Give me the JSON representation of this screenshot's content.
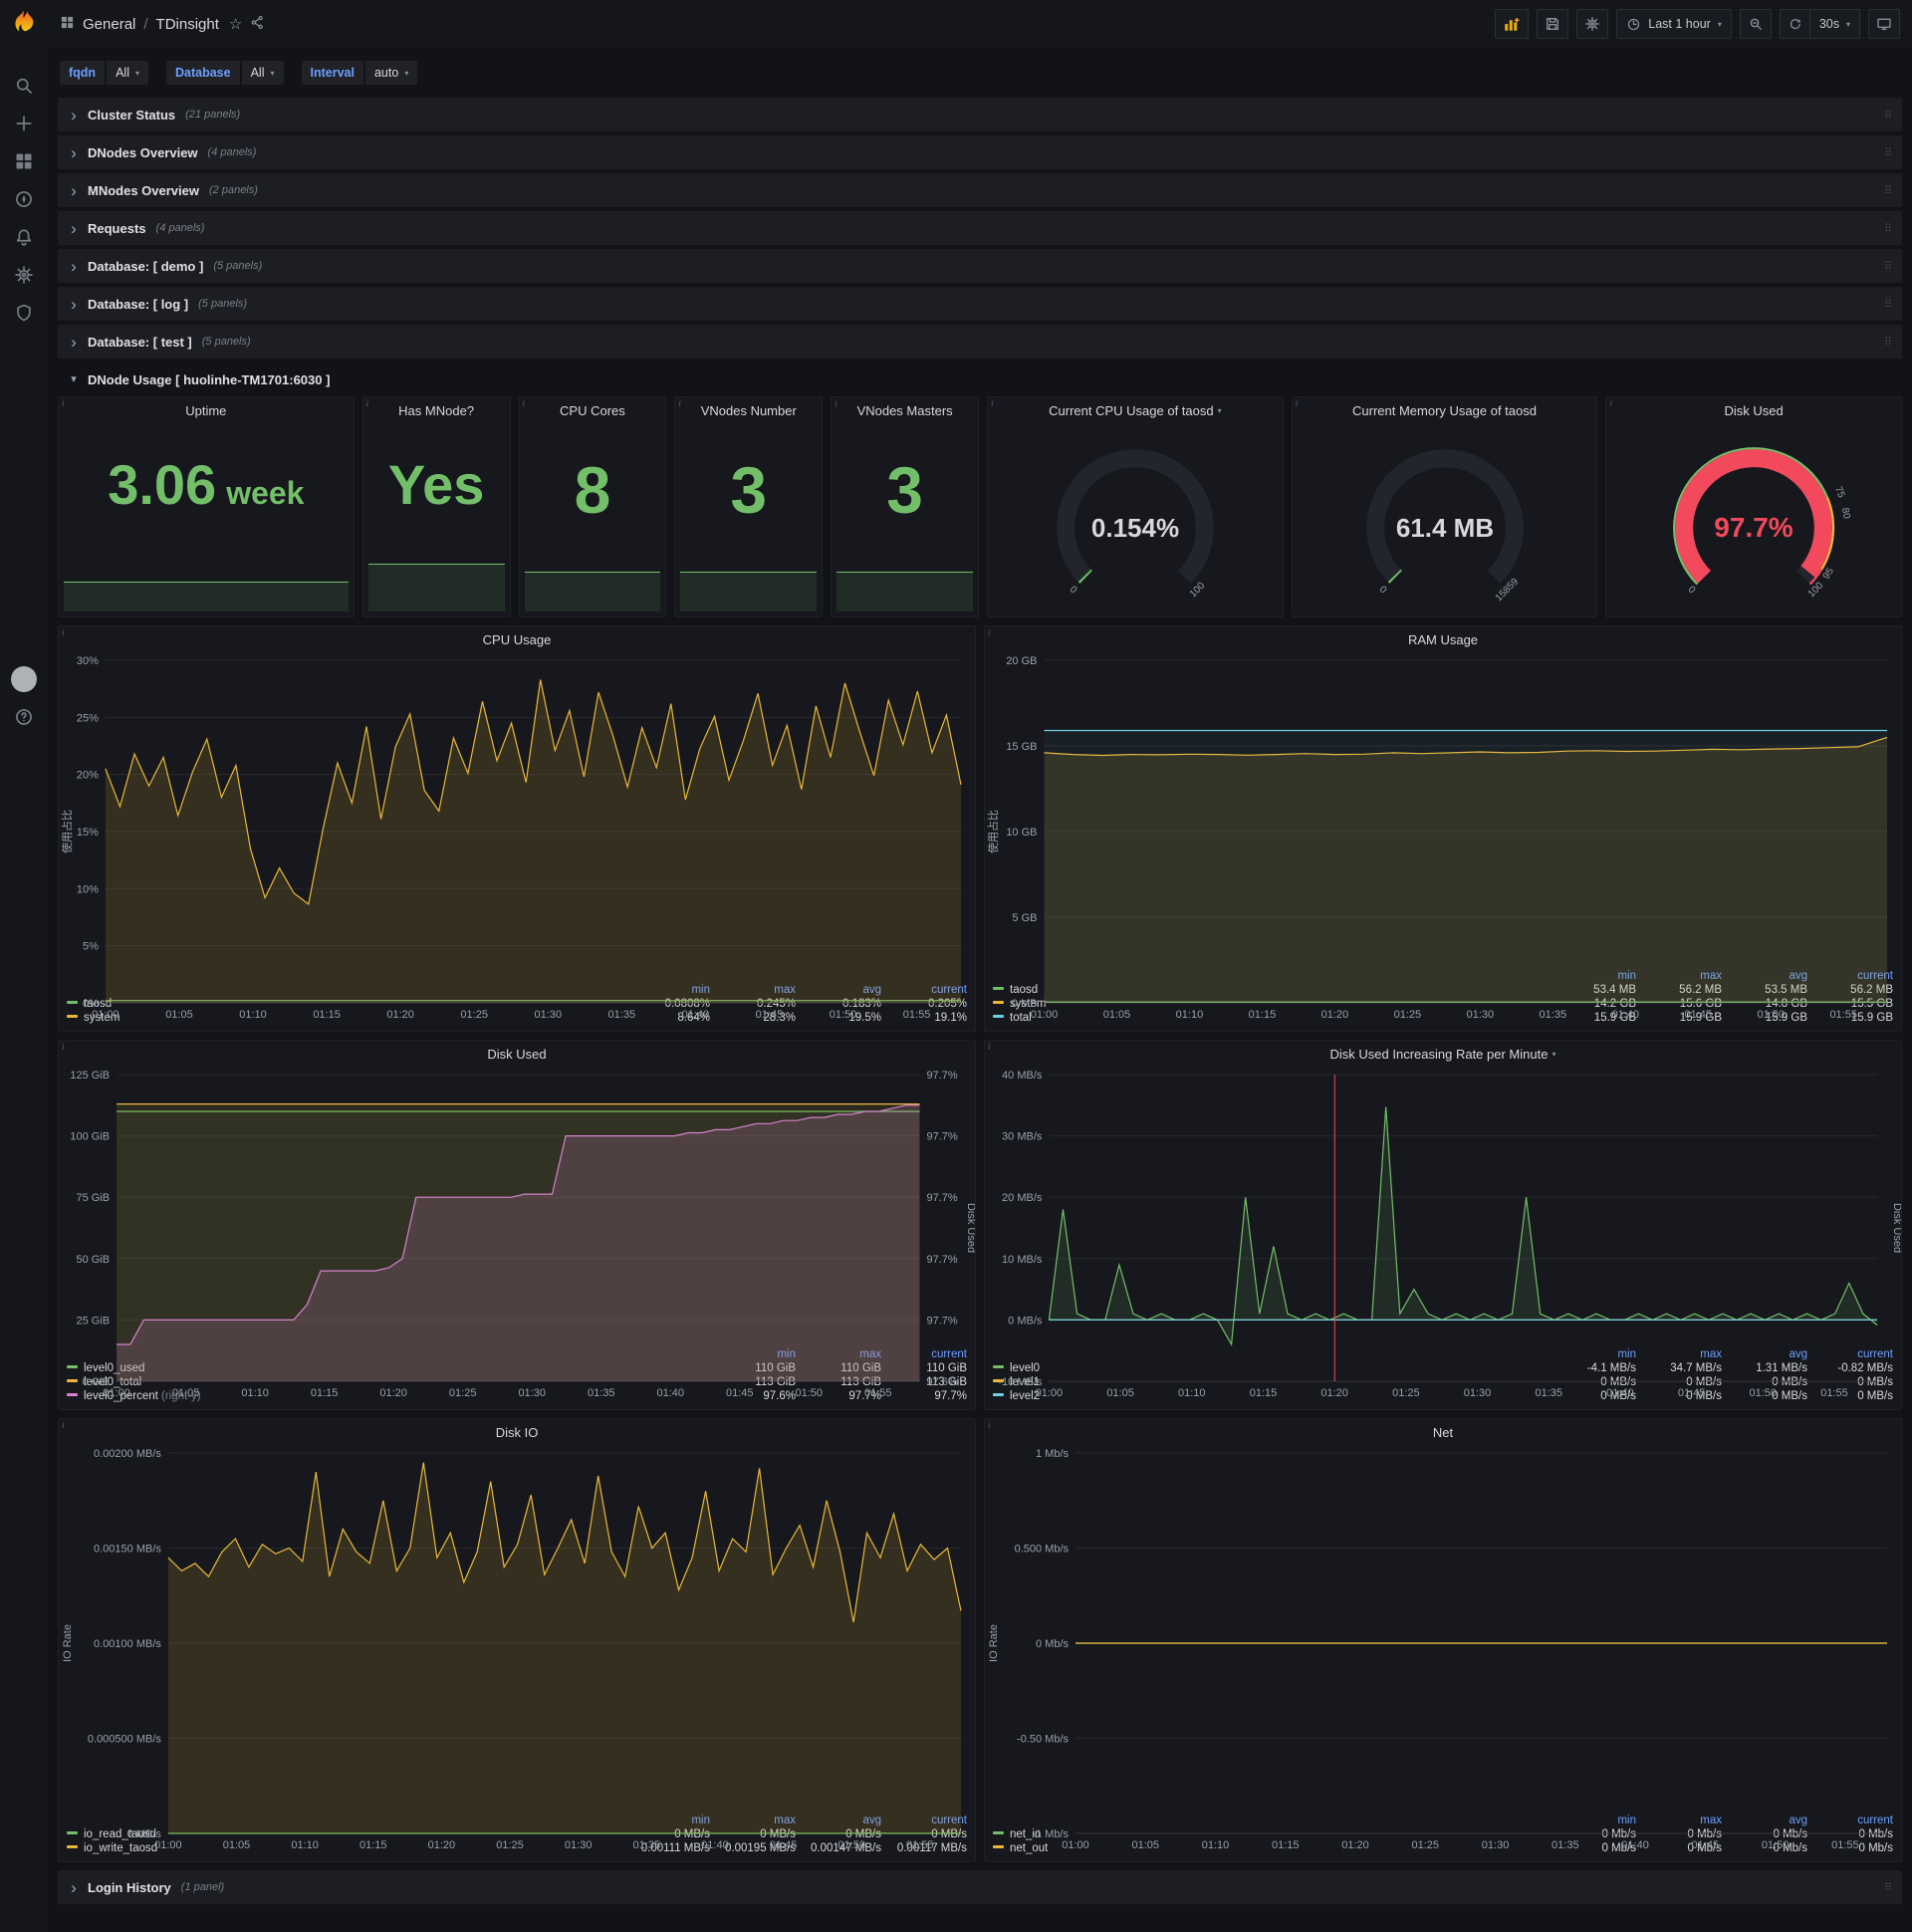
{
  "navbar": {
    "section": "General",
    "title": "TDinsight",
    "time_range": "Last 1 hour",
    "refresh": "30s"
  },
  "glyphs": {
    "info": "i",
    "caret": "▾",
    "collapsed": "›",
    "expanded": "▾",
    "drag": "⠿",
    "star": "☆",
    "sep": "/"
  },
  "colors": {
    "green": "#73bf69",
    "yellow": "#eab839",
    "cyan": "#6ed0e0",
    "red": "#f2495c",
    "pink": "#d683ce",
    "accent_blue": "#6e9fff"
  },
  "variables": [
    {
      "label": "fqdn",
      "value": "All"
    },
    {
      "label": "Database",
      "value": "All"
    },
    {
      "label": "Interval",
      "value": "auto"
    }
  ],
  "rows": [
    {
      "title": "Cluster Status",
      "count": "(21 panels)"
    },
    {
      "title": "DNodes Overview",
      "count": "(4 panels)"
    },
    {
      "title": "MNodes Overview",
      "count": "(2 panels)"
    },
    {
      "title": "Requests",
      "count": "(4 panels)"
    },
    {
      "title": "Database: [ demo ]",
      "count": "(5 panels)"
    },
    {
      "title": "Database: [ log ]",
      "count": "(5 panels)"
    },
    {
      "title": "Database: [ test ]",
      "count": "(5 panels)"
    }
  ],
  "expanded_row_title": "DNode Usage [ huolinhe-TM1701:6030 ]",
  "bottom_row": {
    "title": "Login History",
    "count": "(1 panel)"
  },
  "stats": [
    {
      "title": "Uptime",
      "value": "3.06",
      "unit": "week"
    },
    {
      "title": "Has MNode?",
      "value": "Yes",
      "unit": ""
    },
    {
      "title": "CPU Cores",
      "value": "8",
      "unit": ""
    },
    {
      "title": "VNodes Number",
      "value": "3",
      "unit": ""
    },
    {
      "title": "VNodes Masters",
      "value": "3",
      "unit": ""
    }
  ],
  "gauges": [
    {
      "title": "Current CPU Usage of taosd",
      "has_caret": true,
      "value": "0.154%",
      "fraction": 0.00154,
      "color": "#73bf69",
      "value_color": "#d8d9da",
      "font": 26,
      "scale_labels": [
        {
          "at": 0,
          "text": "0"
        },
        {
          "at": 1,
          "text": "100"
        }
      ]
    },
    {
      "title": "Current Memory Usage of taosd",
      "value": "61.4 MB",
      "fraction": 0.0039,
      "color": "#73bf69",
      "value_color": "#d8d9da",
      "font": 26,
      "scale_labels": [
        {
          "at": 0,
          "text": "0"
        },
        {
          "at": 1,
          "text": "15859"
        }
      ]
    },
    {
      "title": "Disk Used",
      "value": "97.7%",
      "fraction": 0.977,
      "color": "#f2495c",
      "value_color": "#f2495c",
      "font": 28,
      "scale_labels": [
        {
          "at": 0,
          "text": "0"
        },
        {
          "at": 0.75,
          "text": "75"
        },
        {
          "at": 0.8,
          "text": "80"
        },
        {
          "at": 0.95,
          "text": "95"
        },
        {
          "at": 1,
          "text": "100"
        }
      ],
      "thresholds": [
        {
          "from": 0,
          "to": 0.75,
          "color": "#73bf69"
        },
        {
          "from": 0.75,
          "to": 0.95,
          "color": "#eab839"
        },
        {
          "from": 0.95,
          "to": 1,
          "color": "#f2495c"
        }
      ]
    }
  ],
  "chart_data": [
    {
      "type": "line",
      "title": "CPU Usage",
      "ylabel": "使用占比",
      "y_ticks": [
        "30%",
        "25%",
        "20%",
        "15%",
        "10%",
        "5%",
        "0%"
      ],
      "ylim": [
        0,
        30
      ],
      "x_ticks": [
        "01:00",
        "01:05",
        "01:10",
        "01:15",
        "01:20",
        "01:25",
        "01:30",
        "01:35",
        "01:40",
        "01:45",
        "01:50",
        "01:55"
      ],
      "series": [
        {
          "name": "taosd",
          "color": "#73bf69",
          "fill": 0.1,
          "values": [
            0.2,
            0.2
          ]
        },
        {
          "name": "system",
          "color": "#eab839",
          "fill": 0.15,
          "values": [
            20.5,
            17.2,
            21.8,
            19.0,
            21.5,
            16.4,
            20.2,
            23.1,
            18.0,
            20.8,
            13.5,
            9.2,
            11.8,
            9.6,
            8.64,
            15.2,
            21.0,
            17.5,
            24.2,
            16.1,
            22.4,
            25.3,
            18.6,
            16.8,
            23.2,
            20.1,
            26.4,
            21.2,
            24.5,
            19.3,
            28.3,
            22.1,
            25.6,
            19.8,
            27.2,
            23.4,
            18.9,
            24.1,
            20.6,
            26.2,
            17.8,
            22.3,
            25.1,
            19.5,
            23.0,
            27.1,
            20.8,
            24.3,
            18.7,
            26.0,
            21.5,
            28.0,
            23.8,
            19.9,
            26.5,
            22.6,
            27.3,
            21.9,
            25.2,
            19.1
          ]
        }
      ],
      "legend": {
        "columns": [
          "min",
          "max",
          "avg",
          "current"
        ],
        "rows": [
          {
            "name": "taosd",
            "color": "#73bf69",
            "values": [
              "0.0808%",
              "0.245%",
              "0.183%",
              "0.205%"
            ]
          },
          {
            "name": "system",
            "color": "#eab839",
            "values": [
              "8.64%",
              "28.3%",
              "19.5%",
              "19.1%"
            ]
          }
        ]
      }
    },
    {
      "type": "line",
      "title": "RAM Usage",
      "ylabel": "使用占比",
      "y_ticks": [
        "20 GB",
        "15 GB",
        "10 GB",
        "5 GB",
        "0 MB"
      ],
      "ylim": [
        0,
        20
      ],
      "x_ticks": [
        "01:00",
        "01:05",
        "01:10",
        "01:15",
        "01:20",
        "01:25",
        "01:30",
        "01:35",
        "01:40",
        "01:45",
        "01:50",
        "01:55"
      ],
      "series": [
        {
          "name": "taosd",
          "color": "#73bf69",
          "fill": 0.1,
          "values": [
            0.054,
            0.054
          ]
        },
        {
          "name": "system",
          "color": "#eab839",
          "fill": 0.13,
          "values": [
            14.6,
            14.5,
            14.45,
            14.5,
            14.48,
            14.52,
            14.5,
            14.46,
            14.5,
            14.55,
            14.5,
            14.52,
            14.6,
            14.55,
            14.6,
            14.65,
            14.6,
            14.62,
            14.7,
            14.72,
            14.68,
            14.7,
            14.75,
            14.8,
            14.78,
            14.82,
            14.85,
            14.9,
            14.95,
            15.5
          ]
        },
        {
          "name": "total",
          "color": "#6ed0e0",
          "fill": 0.05,
          "values": [
            15.9,
            15.9
          ]
        }
      ],
      "legend": {
        "columns": [
          "min",
          "max",
          "avg",
          "current"
        ],
        "rows": [
          {
            "name": "taosd",
            "color": "#73bf69",
            "values": [
              "53.4 MB",
              "56.2 MB",
              "53.5 MB",
              "56.2 MB"
            ]
          },
          {
            "name": "system",
            "color": "#eab839",
            "values": [
              "14.2 GB",
              "15.6 GB",
              "14.8 GB",
              "15.5 GB"
            ]
          },
          {
            "name": "total",
            "color": "#6ed0e0",
            "values": [
              "15.9 GB",
              "15.9 GB",
              "15.9 GB",
              "15.9 GB"
            ]
          }
        ]
      }
    },
    {
      "type": "line",
      "title": "Disk Used",
      "y_ticks": [
        "125 GiB",
        "100 GiB",
        "75 GiB",
        "50 GiB",
        "25 GiB",
        "0 GiB"
      ],
      "ylim": [
        0,
        125
      ],
      "right_ticks": [
        "97.7%",
        "97.7%",
        "97.7%",
        "97.7%",
        "97.7%",
        "97.6%"
      ],
      "y2lim": [
        97.6,
        97.7
      ],
      "right_label": "Disk Used",
      "x_ticks": [
        "01:00",
        "01:05",
        "01:10",
        "01:15",
        "01:20",
        "01:25",
        "01:30",
        "01:35",
        "01:40",
        "01:45",
        "01:50",
        "01:55"
      ],
      "series": [
        {
          "name": "level0_used",
          "color": "#73bf69",
          "fill": 0.07,
          "values": [
            110,
            110
          ]
        },
        {
          "name": "level0_total",
          "color": "#eab839",
          "fill": 0.1,
          "values": [
            113,
            113
          ]
        },
        {
          "name": "level0_percent",
          "color": "#d683ce",
          "fill": 0.18,
          "yaxis": 2,
          "values": [
            97.612,
            97.612,
            97.62,
            97.62,
            97.62,
            97.62,
            97.62,
            97.62,
            97.62,
            97.62,
            97.62,
            97.62,
            97.62,
            97.62,
            97.625,
            97.636,
            97.636,
            97.636,
            97.636,
            97.636,
            97.637,
            97.64,
            97.66,
            97.66,
            97.66,
            97.66,
            97.66,
            97.66,
            97.66,
            97.66,
            97.661,
            97.661,
            97.661,
            97.68,
            97.68,
            97.68,
            97.68,
            97.68,
            97.68,
            97.68,
            97.68,
            97.68,
            97.681,
            97.681,
            97.682,
            97.682,
            97.683,
            97.684,
            97.684,
            97.685,
            97.685,
            97.686,
            97.686,
            97.687,
            97.687,
            97.688,
            97.688,
            97.689,
            97.69,
            97.69
          ]
        }
      ],
      "legend": {
        "columns": [
          "min",
          "max",
          "current"
        ],
        "rows": [
          {
            "name": "level0_used",
            "color": "#73bf69",
            "values": [
              "110 GiB",
              "110 GiB",
              "110 GiB"
            ]
          },
          {
            "name": "level0_total",
            "color": "#eab839",
            "values": [
              "113 GiB",
              "113 GiB",
              "113 GiB"
            ]
          },
          {
            "name": "level0_percent",
            "suffix": "(right-y)",
            "color": "#d683ce",
            "values": [
              "97.6%",
              "97.7%",
              "97.7%"
            ]
          }
        ]
      }
    },
    {
      "type": "line",
      "title": "Disk Used Increasing Rate per Minute",
      "has_caret": true,
      "y_ticks": [
        "40 MB/s",
        "30 MB/s",
        "20 MB/s",
        "10 MB/s",
        "0 MB/s",
        "-10 MB/s"
      ],
      "ylim": [
        -10,
        40
      ],
      "right_label": "Disk Used",
      "annotation_x": 0.345,
      "x_ticks": [
        "01:00",
        "01:05",
        "01:10",
        "01:15",
        "01:20",
        "01:25",
        "01:30",
        "01:35",
        "01:40",
        "01:45",
        "01:50",
        "01:55"
      ],
      "series": [
        {
          "name": "level0",
          "color": "#73bf69",
          "fill": 0.12,
          "values": [
            0,
            18,
            1,
            0,
            0,
            9,
            1,
            0,
            1,
            0,
            0,
            1,
            0,
            -4,
            20,
            1,
            12,
            1,
            0,
            1,
            0,
            1,
            0,
            0,
            34.7,
            1,
            5,
            1,
            0,
            1,
            0,
            1,
            0,
            1,
            20,
            1,
            0,
            1,
            0,
            1,
            0,
            0,
            1,
            0,
            1,
            0,
            1,
            0,
            1,
            0,
            1,
            0,
            1,
            0,
            1,
            0,
            1,
            6,
            1,
            -0.82
          ]
        },
        {
          "name": "level1",
          "color": "#eab839",
          "fill": 0,
          "values": [
            0,
            0
          ]
        },
        {
          "name": "level2",
          "color": "#6ed0e0",
          "fill": 0,
          "values": [
            0,
            0
          ]
        }
      ],
      "legend": {
        "columns": [
          "min",
          "max",
          "avg",
          "current"
        ],
        "rows": [
          {
            "name": "level0",
            "color": "#73bf69",
            "values": [
              "-4.1 MB/s",
              "34.7 MB/s",
              "1.31 MB/s",
              "-0.82 MB/s"
            ]
          },
          {
            "name": "level1",
            "color": "#eab839",
            "values": [
              "0 MB/s",
              "0 MB/s",
              "0 MB/s",
              "0 MB/s"
            ]
          },
          {
            "name": "level2",
            "color": "#6ed0e0",
            "values": [
              "0 MB/s",
              "0 MB/s",
              "0 MB/s",
              "0 MB/s"
            ]
          }
        ]
      }
    },
    {
      "type": "line",
      "title": "Disk IO",
      "ylabel": "IO Rate",
      "y_ticks": [
        "0.00200 MB/s",
        "0.00150 MB/s",
        "0.00100 MB/s",
        "0.000500 MB/s",
        "0 MB/s"
      ],
      "ylim": [
        0,
        0.002
      ],
      "x_ticks": [
        "01:00",
        "01:05",
        "01:10",
        "01:15",
        "01:20",
        "01:25",
        "01:30",
        "01:35",
        "01:40",
        "01:45",
        "01:50",
        "01:55"
      ],
      "series": [
        {
          "name": "io_read_taosd",
          "color": "#73bf69",
          "fill": 0.1,
          "values": [
            0,
            0
          ]
        },
        {
          "name": "io_write_taosd",
          "color": "#eab839",
          "fill": 0.15,
          "values": [
            0.00145,
            0.00138,
            0.00142,
            0.00135,
            0.00148,
            0.00155,
            0.0014,
            0.00152,
            0.00147,
            0.0015,
            0.00143,
            0.0019,
            0.00135,
            0.0016,
            0.00148,
            0.00142,
            0.00175,
            0.00138,
            0.0015,
            0.00195,
            0.00145,
            0.00158,
            0.00132,
            0.00148,
            0.00185,
            0.0014,
            0.00152,
            0.00178,
            0.00136,
            0.0015,
            0.00165,
            0.00142,
            0.00188,
            0.00148,
            0.00135,
            0.00172,
            0.0015,
            0.00158,
            0.00128,
            0.00145,
            0.0018,
            0.00138,
            0.00155,
            0.00148,
            0.00192,
            0.00136,
            0.0015,
            0.00162,
            0.0014,
            0.00175,
            0.00148,
            0.00111,
            0.00158,
            0.00145,
            0.00168,
            0.00138,
            0.00152,
            0.00144,
            0.0015,
            0.00117
          ]
        }
      ],
      "legend": {
        "columns": [
          "min",
          "max",
          "avg",
          "current"
        ],
        "rows": [
          {
            "name": "io_read_taosd",
            "color": "#73bf69",
            "values": [
              "0 MB/s",
              "0 MB/s",
              "0 MB/s",
              "0 MB/s"
            ]
          },
          {
            "name": "io_write_taosd",
            "color": "#eab839",
            "values": [
              "0.00111 MB/s",
              "0.00195 MB/s",
              "0.00147 MB/s",
              "0.00117 MB/s"
            ]
          }
        ]
      }
    },
    {
      "type": "line",
      "title": "Net",
      "ylabel": "IO Rate",
      "y_ticks": [
        "1 Mb/s",
        "0.500 Mb/s",
        "0 Mb/s",
        "-0.50 Mb/s",
        "-1 Mb/s"
      ],
      "ylim": [
        -1,
        1
      ],
      "x_ticks": [
        "01:00",
        "01:05",
        "01:10",
        "01:15",
        "01:20",
        "01:25",
        "01:30",
        "01:35",
        "01:40",
        "01:45",
        "01:50",
        "01:55"
      ],
      "series": [
        {
          "name": "net_in",
          "color": "#73bf69",
          "fill": 0.1,
          "values": [
            0,
            0
          ]
        },
        {
          "name": "net_out",
          "color": "#eab839",
          "fill": 0.1,
          "values": [
            0,
            0
          ]
        }
      ],
      "legend": {
        "columns": [
          "min",
          "max",
          "avg",
          "current"
        ],
        "rows": [
          {
            "name": "net_in",
            "color": "#73bf69",
            "values": [
              "0 Mb/s",
              "0 Mb/s",
              "0 Mb/s",
              "0 Mb/s"
            ]
          },
          {
            "name": "net_out",
            "color": "#eab839",
            "values": [
              "0 Mb/s",
              "0 Mb/s",
              "0 Mb/s",
              "0 Mb/s"
            ]
          }
        ]
      }
    }
  ]
}
